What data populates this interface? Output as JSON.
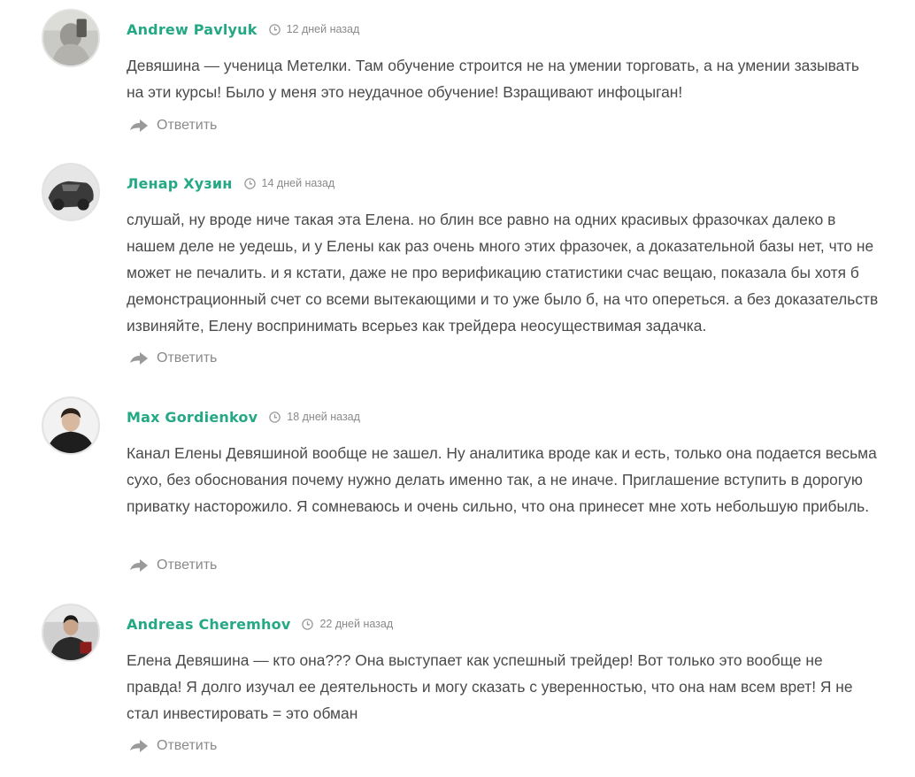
{
  "reply_label": "Ответить",
  "comments": [
    {
      "author": "Andrew Pavlyuk",
      "date": "12 дней назад",
      "text": "Девяшина — ученица Метелки. Там обучение строится не на умении торговать, а на умении зазывать на эти курсы! Было у меня это неудачное обучение! Взращивают инфоцыган!"
    },
    {
      "author": "Ленар Хузин",
      "date": "14 дней назад",
      "text": "слушай, ну вроде ниче такая эта Елена. но блин все равно на одних красивых фразочках далеко в нашем деле не уедешь, и у Елены как раз очень много этих фразочек, а доказательной базы нет, что не может не печалить. и я кстати, даже не про верификацию статистики счас вещаю, показала бы хотя б демонстрационный счет со всеми вытекающими и то уже было б, на что опереться. а без доказательств извиняйте, Елену воспринимать всерьез как трейдера неосуществимая задачка."
    },
    {
      "author": "Max Gordienkov",
      "date": "18 дней назад",
      "text": "Канал Елены Девяшиной вообще не зашел. Ну аналитика вроде как и есть, только она подается весьма сухо, без обоснования почему нужно делать именно так, а не иначе. Приглашение вступить в дорогую приватку насторожило. Я сомневаюсь и очень сильно, что она принесет мне хоть небольшую прибыль."
    },
    {
      "author": "Andreas Cheremhov",
      "date": "22 дней назад",
      "text": "Елена Девяшина — кто она??? Она выступает как успешный трейдер! Вот только это вообще не правда! Я долго изучал ее деятельность и могу сказать с уверенностью, что она нам всем врет! Я не стал инвестировать = это обман"
    }
  ],
  "colors": {
    "author": "#25a885",
    "text": "#4a4a4a",
    "muted": "#8a8a8a"
  },
  "icons": {
    "clock": "clock-icon",
    "reply": "reply-arrow-icon"
  }
}
